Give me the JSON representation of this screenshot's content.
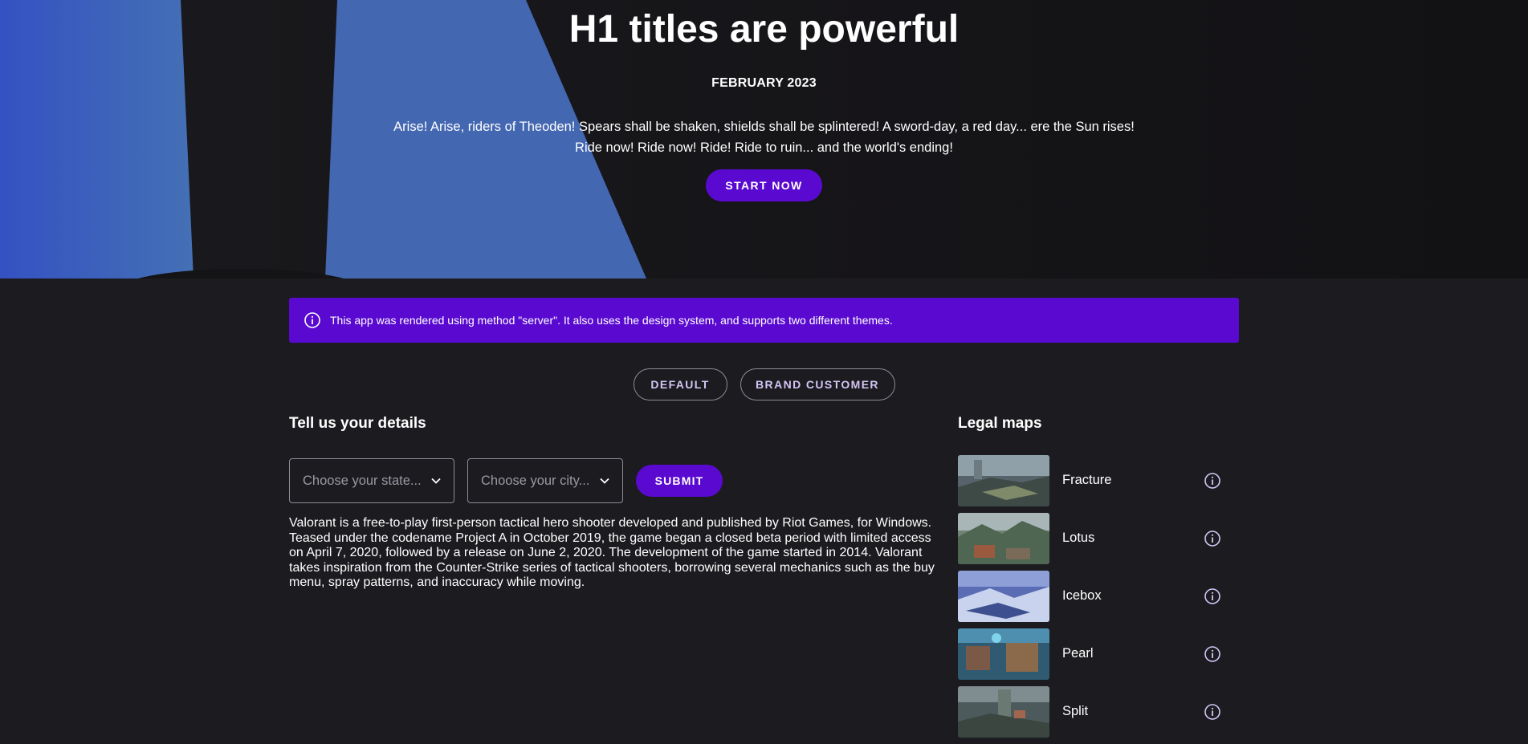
{
  "hero": {
    "title": "H1 titles are powerful",
    "date": "FEBRUARY 2023",
    "text": "Arise! Arise, riders of Theoden! Spears shall be shaken, shields shall be splintered! A sword-day, a red day... ere the Sun rises! Ride now! Ride now! Ride! Ride to ruin... and the world's ending!",
    "cta_label": "START NOW"
  },
  "notice": {
    "icon": "info-icon",
    "text": "This app was rendered using method \"server\". It also uses the design system, and supports two different themes."
  },
  "theme_switch": {
    "default_label": "DEFAULT",
    "brand_label": "BRAND CUSTOMER"
  },
  "details": {
    "title": "Tell us your details",
    "state_placeholder": "Choose your state...",
    "city_placeholder": "Choose your city...",
    "submit_label": "SUBMIT",
    "description": "Valorant is a free-to-play first-person tactical hero shooter developed and published by Riot Games, for Windows. Teased under the codename Project A in October 2019, the game began a closed beta period with limited access on April 7, 2020, followed by a release on June 2, 2020. The development of the game started in 2014. Valorant takes inspiration from the Counter-Strike series of tactical shooters, borrowing several mechanics such as the buy menu, spray patterns, and inaccuracy while moving."
  },
  "maps": {
    "title": "Legal maps",
    "items": [
      {
        "name": "Fracture",
        "icon": "info-icon"
      },
      {
        "name": "Lotus",
        "icon": "info-icon"
      },
      {
        "name": "Icebox",
        "icon": "info-icon"
      },
      {
        "name": "Pearl",
        "icon": "info-icon"
      },
      {
        "name": "Split",
        "icon": "info-icon"
      }
    ]
  },
  "colors": {
    "accent": "#5a0ad0",
    "background": "#1c1b1f",
    "hero_blue": "#3f66b3"
  }
}
